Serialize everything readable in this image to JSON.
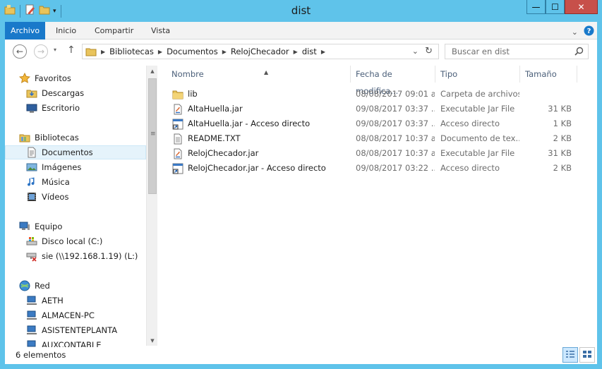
{
  "window": {
    "title": "dist",
    "minimize_label": "—",
    "maximize_label": "☐",
    "close_label": "✕"
  },
  "ribbon": {
    "tabs": [
      "Archivo",
      "Inicio",
      "Compartir",
      "Vista"
    ]
  },
  "address": {
    "crumbs": [
      "Bibliotecas",
      "Documentos",
      "RelojChecador",
      "dist"
    ]
  },
  "search": {
    "placeholder": "Buscar en dist"
  },
  "nav": {
    "groups": [
      {
        "label": "Favoritos",
        "icon": "star-icon"
      },
      {
        "label": "Descargas",
        "icon": "downloads-folder-icon"
      },
      {
        "label": "Escritorio",
        "icon": "desktop-icon"
      },
      {
        "label": "Bibliotecas",
        "icon": "libraries-icon"
      },
      {
        "label": "Documentos",
        "icon": "documents-icon"
      },
      {
        "label": "Imágenes",
        "icon": "pictures-icon"
      },
      {
        "label": "Música",
        "icon": "music-icon"
      },
      {
        "label": "Vídeos",
        "icon": "videos-icon"
      },
      {
        "label": "Equipo",
        "icon": "computer-icon"
      },
      {
        "label": "Disco local (C:)",
        "icon": "local-disk-icon"
      },
      {
        "label": "sie (\\\\192.168.1.19) (L:)",
        "icon": "network-drive-disconnected-icon"
      },
      {
        "label": "Red",
        "icon": "network-icon"
      },
      {
        "label": "AETH",
        "icon": "network-computer-icon"
      },
      {
        "label": "ALMACEN-PC",
        "icon": "network-computer-icon"
      },
      {
        "label": "ASISTENTEPLANTA",
        "icon": "network-computer-icon"
      },
      {
        "label": "AUXCONTABLE",
        "icon": "network-computer-icon"
      }
    ],
    "selected": "Documentos"
  },
  "columns": [
    "Nombre",
    "Fecha de modifica...",
    "Tipo",
    "Tamaño"
  ],
  "files": [
    {
      "name": "lib",
      "date": "08/08/2017 09:01 a...",
      "type": "Carpeta de archivos",
      "size": "",
      "icon": "folder-icon"
    },
    {
      "name": "AltaHuella.jar",
      "date": "09/08/2017 03:37 ...",
      "type": "Executable Jar File",
      "size": "31 KB",
      "icon": "jar-file-icon"
    },
    {
      "name": "AltaHuella.jar - Acceso directo",
      "date": "09/08/2017 03:37 ...",
      "type": "Acceso directo",
      "size": "1 KB",
      "icon": "shortcut-icon"
    },
    {
      "name": "README.TXT",
      "date": "08/08/2017 10:37 a...",
      "type": "Documento de tex...",
      "size": "2 KB",
      "icon": "text-file-icon"
    },
    {
      "name": "RelojChecador.jar",
      "date": "08/08/2017 10:37 a...",
      "type": "Executable Jar File",
      "size": "31 KB",
      "icon": "jar-file-icon"
    },
    {
      "name": "RelojChecador.jar - Acceso directo",
      "date": "09/08/2017 03:22 ...",
      "type": "Acceso directo",
      "size": "2 KB",
      "icon": "shortcut-icon"
    }
  ],
  "status": {
    "count": "6 elementos"
  },
  "colors": {
    "frame": "#5fc3ea",
    "file_tab": "#1979ca",
    "close": "#c7504a",
    "selected": "#e5f3fb"
  }
}
